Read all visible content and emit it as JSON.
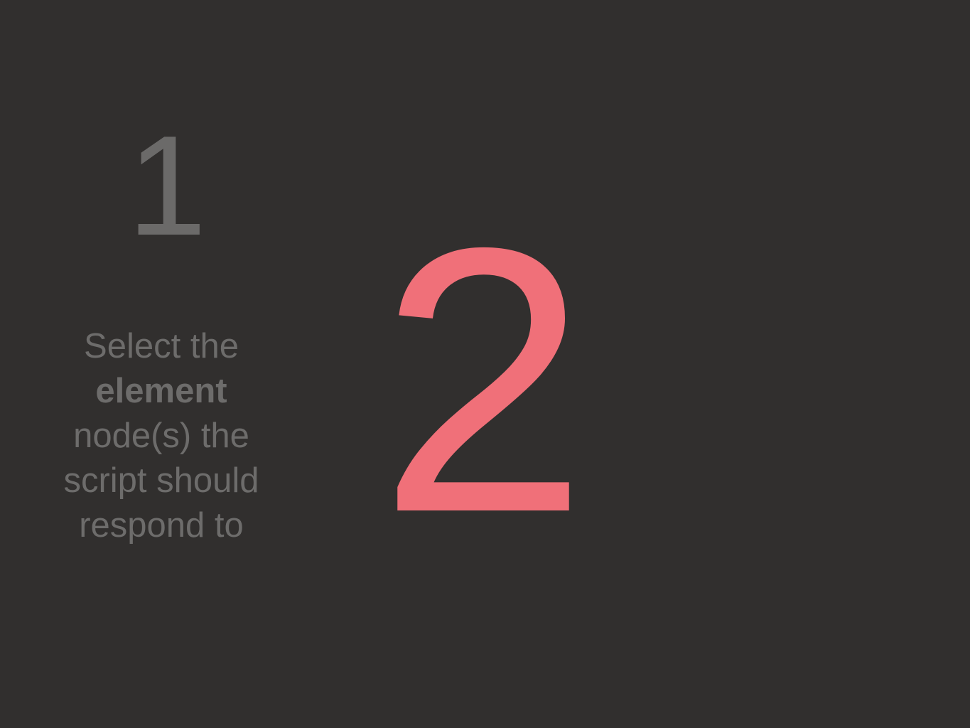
{
  "slide": {
    "step_1": {
      "number": "1",
      "text_line_1": "Select the",
      "text_line_2_bold": "element",
      "text_line_3": "node(s) the",
      "text_line_4": "script should",
      "text_line_5": "respond to"
    },
    "step_2": {
      "number": "2"
    }
  },
  "colors": {
    "background": "#312f2e",
    "muted_text": "#6d6c6b",
    "accent": "#f07079"
  }
}
